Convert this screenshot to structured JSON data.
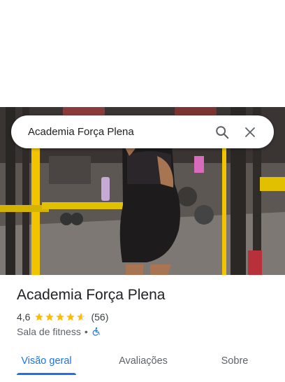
{
  "search": {
    "query": "Academia Força Plena"
  },
  "place": {
    "name": "Academia Força Plena",
    "rating": "4,6",
    "stars": 4.6,
    "review_count": "(56)",
    "category": "Sala de fitness",
    "separator": "•",
    "accessibility_icon": "wheelchair-icon"
  },
  "tabs": [
    {
      "label": "Visão geral",
      "active": true
    },
    {
      "label": "Avaliações",
      "active": false
    },
    {
      "label": "Sobre",
      "active": false
    }
  ],
  "colors": {
    "accent": "#1a73e8",
    "star": "#fbbc04",
    "text_primary": "#202124",
    "text_secondary": "#5f6368"
  },
  "icons": {
    "search": "search-icon",
    "close": "close-icon"
  }
}
